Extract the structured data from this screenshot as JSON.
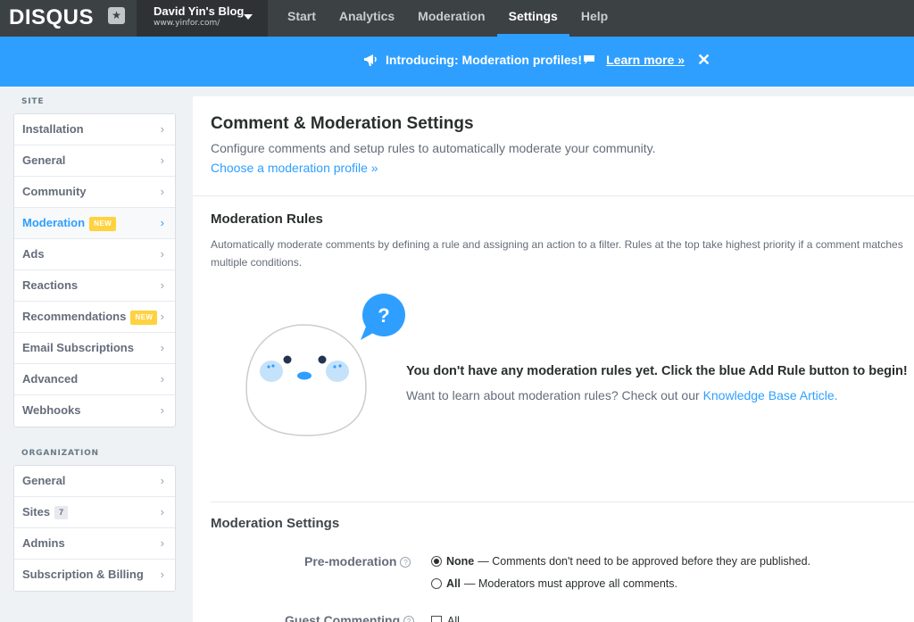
{
  "topbar": {
    "logo": "DISQUS",
    "logo_badge_icon": "star-icon",
    "site_name": "David Yin's Blog",
    "site_url": "www.yinfor.com/",
    "nav": [
      {
        "label": "Start"
      },
      {
        "label": "Analytics"
      },
      {
        "label": "Moderation"
      },
      {
        "label": "Settings",
        "active": true
      },
      {
        "label": "Help"
      }
    ]
  },
  "banner": {
    "text": "Introducing: Moderation profiles!",
    "link": "Learn more »",
    "close": "✕",
    "icon": "megaphone-icon"
  },
  "sidebar": {
    "site_heading": "SITE",
    "site_items": [
      {
        "label": "Installation"
      },
      {
        "label": "General"
      },
      {
        "label": "Community"
      },
      {
        "label": "Moderation",
        "badge": "NEW",
        "active": true
      },
      {
        "label": "Ads"
      },
      {
        "label": "Reactions"
      },
      {
        "label": "Recommendations",
        "badge": "NEW"
      },
      {
        "label": "Email Subscriptions"
      },
      {
        "label": "Advanced"
      },
      {
        "label": "Webhooks"
      }
    ],
    "org_heading": "ORGANIZATION",
    "org_items": [
      {
        "label": "General"
      },
      {
        "label": "Sites",
        "count": "7"
      },
      {
        "label": "Admins"
      },
      {
        "label": "Subscription & Billing"
      }
    ]
  },
  "main": {
    "title": "Comment & Moderation Settings",
    "description": "Configure comments and setup rules to automatically moderate your community.",
    "profile_link": "Choose a moderation profile »",
    "rules_title": "Moderation Rules",
    "rules_description": "Automatically moderate comments by defining a rule and assigning an action to a filter. Rules at the top take highest priority if a comment matches multiple conditions.",
    "empty_title": "You don't have any moderation rules yet. Click the blue Add Rule button to begin!",
    "empty_desc_prefix": "Want to learn about moderation rules? Check out our ",
    "empty_desc_link": "Knowledge Base Article.",
    "settings_title": "Moderation Settings",
    "premod_label": "Pre-moderation",
    "premod_options": [
      {
        "strong": "None",
        "text": "— Comments don't need to be approved before they are published.",
        "checked": true
      },
      {
        "strong": "All",
        "text": "— Moderators must approve all comments.",
        "checked": false
      }
    ],
    "guest_label": "Guest Commenting",
    "guest_option": "All"
  },
  "colors": {
    "accent": "#2e9fff",
    "nav_bg": "#3c4144",
    "badge_new": "#ffd23f"
  }
}
